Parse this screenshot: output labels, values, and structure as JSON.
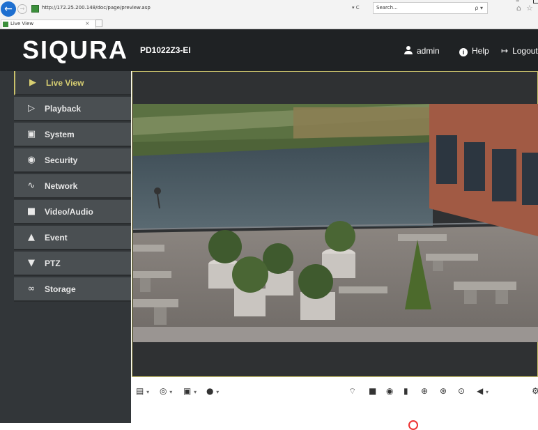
{
  "browser": {
    "url": "http://172.25.200.148/doc/page/preview.asp",
    "url_controls": "▾ C",
    "search_placeholder": "Search...",
    "search_icon": "ρ ▾",
    "tab_title": "Live View",
    "tab_close": "×",
    "minimize": "–"
  },
  "header": {
    "logo": "SIQURA",
    "model": "PD1022Z3-EI",
    "user": "admin",
    "help": "Help",
    "logout": "Logout"
  },
  "sidebar": {
    "items": [
      {
        "label": "Live View",
        "icon": "play-icon"
      },
      {
        "label": "Playback",
        "icon": "playback-icon"
      },
      {
        "label": "System",
        "icon": "system-icon"
      },
      {
        "label": "Security",
        "icon": "lock-icon"
      },
      {
        "label": "Network",
        "icon": "network-icon"
      },
      {
        "label": "Video/Audio",
        "icon": "camera-icon"
      },
      {
        "label": "Event",
        "icon": "event-icon"
      },
      {
        "label": "PTZ",
        "icon": "ptz-icon"
      },
      {
        "label": "Storage",
        "icon": "storage-icon"
      }
    ]
  },
  "toolbar": {
    "left": [
      "window-layout-icon",
      "stream-type-icon",
      "plugin-icon",
      "microphone-icon"
    ],
    "right": [
      "crop-icon",
      "stop-icon",
      "snapshot-icon",
      "record-icon",
      "zoom-icon",
      "focus-icon",
      "iris-icon",
      "volume-icon",
      "settings-icon"
    ]
  },
  "colors": {
    "accent": "#d8cf72",
    "header_bg": "#1f2224",
    "sidebar_bg": "#323639"
  }
}
